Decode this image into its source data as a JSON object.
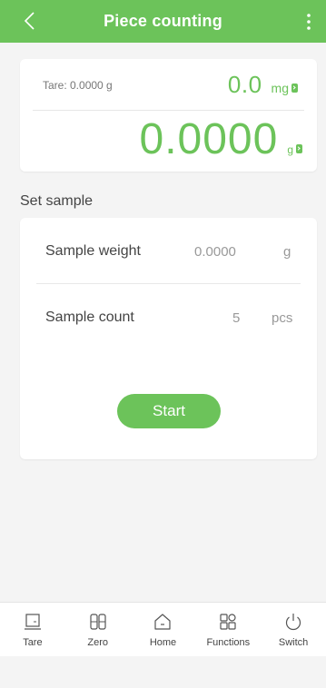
{
  "header": {
    "title": "Piece counting",
    "back_icon": "chevron-left-icon",
    "more_icon": "more-vertical-icon",
    "bg_color": "#6cc35a"
  },
  "weight": {
    "tare_text": "Tare: 0.0000 g",
    "small_value": "0.0",
    "small_unit": "mg",
    "big_value": "0.0000",
    "big_unit": "g",
    "accent_color": "#6cc35a"
  },
  "sample": {
    "section_label": "Set sample",
    "weight_label": "Sample weight",
    "weight_value": "0.0000",
    "weight_unit": "g",
    "count_label": "Sample count",
    "count_value": "5",
    "count_unit": "pcs",
    "start_label": "Start"
  },
  "tabbar": {
    "items": [
      {
        "label": "Tare",
        "icon": "tare-icon"
      },
      {
        "label": "Zero",
        "icon": "zero-icon"
      },
      {
        "label": "Home",
        "icon": "home-icon"
      },
      {
        "label": "Functions",
        "icon": "functions-icon"
      },
      {
        "label": "Switch",
        "icon": "power-icon"
      }
    ]
  }
}
